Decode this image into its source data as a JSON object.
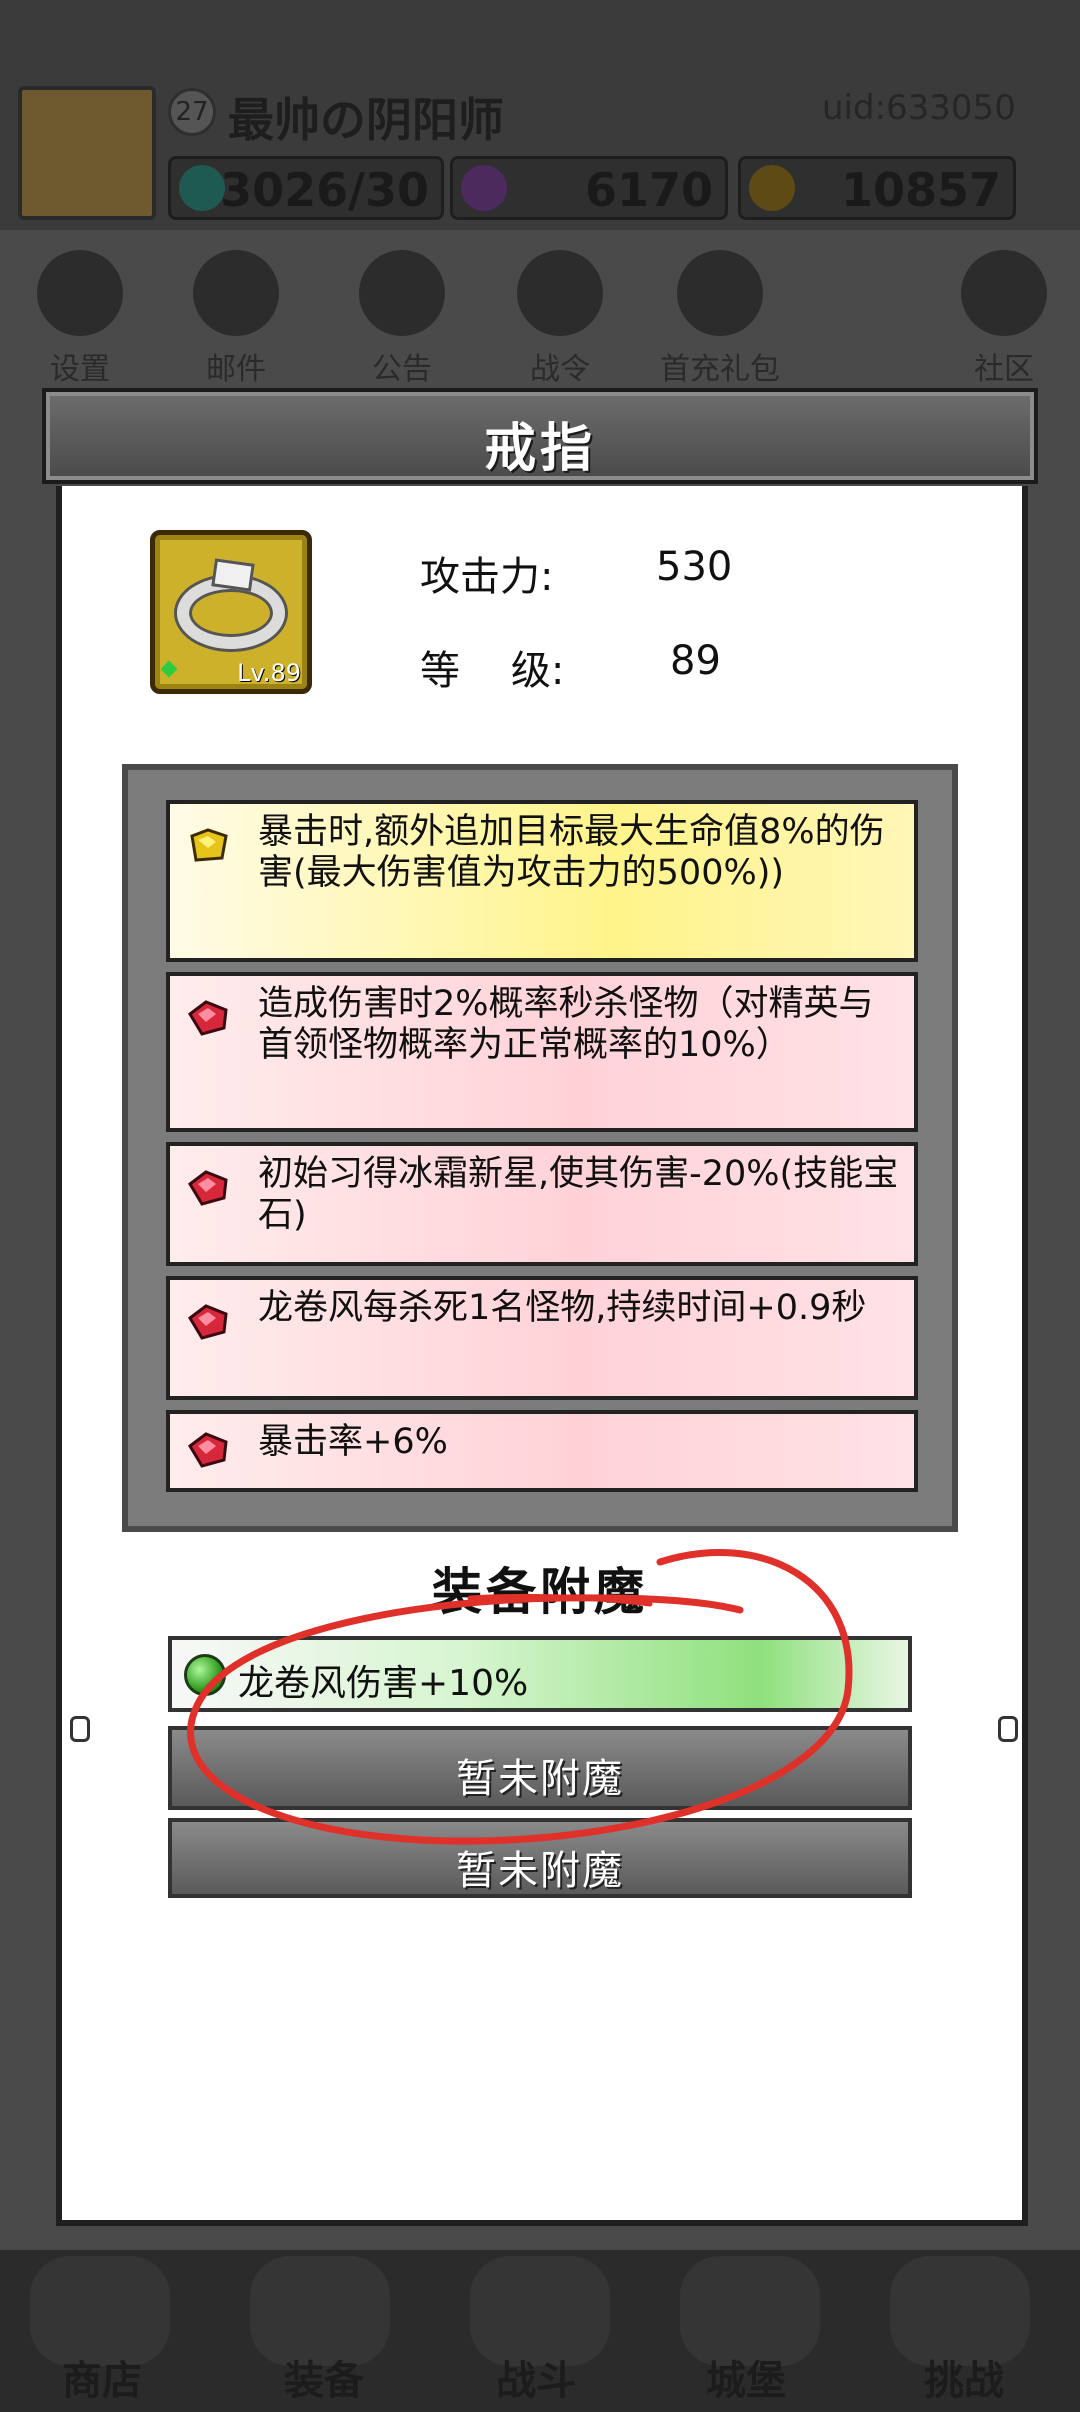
{
  "background": {
    "player": {
      "level": "27",
      "name": "最帅の阴阳师",
      "uid": "uid:633050"
    },
    "resources": [
      {
        "icon": "energy-gem-icon",
        "value": "3026/30",
        "color": "#3fb6a8"
      },
      {
        "icon": "purple-diamond-icon",
        "value": "6170",
        "color": "#a44ad6"
      },
      {
        "icon": "gold-coin-icon",
        "value": "10857",
        "color": "#e0a320"
      }
    ],
    "nav": [
      {
        "icon": "gear-icon",
        "label": "设置"
      },
      {
        "icon": "mail-icon",
        "label": "邮件"
      },
      {
        "icon": "scroll-icon",
        "label": "公告"
      },
      {
        "icon": "crystal-ball-icon",
        "label": "战令"
      },
      {
        "icon": "gift-bag-icon",
        "label": "首充礼包"
      },
      {
        "icon": "home-icon",
        "label": "社区"
      }
    ],
    "bottom_tabs": [
      {
        "icon": "shop-icon",
        "label": "商店"
      },
      {
        "icon": "equipment-icon",
        "label": "装备"
      },
      {
        "icon": "swords-icon",
        "label": "战斗"
      },
      {
        "icon": "castle-icon",
        "label": "城堡"
      },
      {
        "icon": "challenge-icon",
        "label": "挑战"
      }
    ]
  },
  "modal": {
    "title": "戒指",
    "item": {
      "icon": "ring-icon",
      "level_badge": "Lv.89"
    },
    "stats": [
      {
        "label": "攻击力:",
        "value": "530"
      },
      {
        "label": "等    级:",
        "value": "89"
      }
    ],
    "attributes": [
      {
        "gem": "yellow-gem-icon",
        "style": "yellow",
        "text": "暴击时,额外追加目标最大生命值8%的伤害(最大伤害值为攻击力的500%))"
      },
      {
        "gem": "red-gem-icon",
        "style": "red",
        "text": "造成伤害时2%概率秒杀怪物（对精英与首领怪物概率为正常概率的10%）"
      },
      {
        "gem": "red-gem-icon",
        "style": "red",
        "text": "初始习得冰霜新星,使其伤害-20%(技能宝石)"
      },
      {
        "gem": "red-gem-icon",
        "style": "red",
        "text": "龙卷风每杀死1名怪物,持续时间+0.9秒"
      },
      {
        "gem": "red-gem-icon",
        "style": "red",
        "text": "暴击率+6%"
      }
    ],
    "enchant_title": "装备附魔",
    "enchants": [
      {
        "state": "active",
        "icon": "green-orb-icon",
        "text": "龙卷风伤害+10%"
      },
      {
        "state": "empty",
        "text": "暂未附魔"
      },
      {
        "state": "empty",
        "text": "暂未附魔"
      }
    ]
  },
  "colors": {
    "annotation_red": "#e0302a",
    "panel_gray": "#7b7b7b"
  }
}
